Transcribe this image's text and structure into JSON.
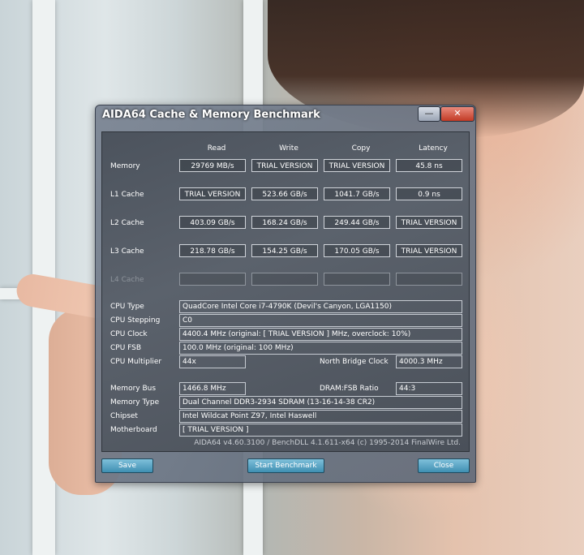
{
  "window": {
    "title": "AIDA64 Cache & Memory Benchmark",
    "min_glyph": "—",
    "close_glyph": "✕"
  },
  "headers": {
    "read": "Read",
    "write": "Write",
    "copy": "Copy",
    "latency": "Latency"
  },
  "rows": [
    {
      "label": "Memory",
      "read": "29769 MB/s",
      "write": "TRIAL VERSION",
      "copy": "TRIAL VERSION",
      "latency": "45.8 ns"
    },
    {
      "label": "L1 Cache",
      "read": "TRIAL VERSION",
      "write": "523.66 GB/s",
      "copy": "1041.7 GB/s",
      "latency": "0.9 ns"
    },
    {
      "label": "L2 Cache",
      "read": "403.09 GB/s",
      "write": "168.24 GB/s",
      "copy": "249.44 GB/s",
      "latency": "TRIAL VERSION"
    },
    {
      "label": "L3 Cache",
      "read": "218.78 GB/s",
      "write": "154.25 GB/s",
      "copy": "170.05 GB/s",
      "latency": "TRIAL VERSION"
    },
    {
      "label": "L4 Cache",
      "read": "",
      "write": "",
      "copy": "",
      "latency": ""
    }
  ],
  "cpu": {
    "type_label": "CPU Type",
    "type": "QuadCore Intel Core i7-4790K  (Devil's Canyon, LGA1150)",
    "stepping_label": "CPU Stepping",
    "stepping": "C0",
    "clock_label": "CPU Clock",
    "clock": "4400.4 MHz  (original: [ TRIAL VERSION ] MHz, overclock: 10%)",
    "fsb_label": "CPU FSB",
    "fsb": "100.0 MHz  (original: 100 MHz)",
    "multiplier_label": "CPU Multiplier",
    "multiplier": "44x",
    "nb_clock_label": "North Bridge Clock",
    "nb_clock": "4000.3 MHz"
  },
  "memory": {
    "bus_label": "Memory Bus",
    "bus": "1466.8 MHz",
    "ratio_label": "DRAM:FSB Ratio",
    "ratio": "44:3",
    "type_label": "Memory Type",
    "type": "Dual Channel DDR3-2934 SDRAM  (13-16-14-38 CR2)",
    "chipset_label": "Chipset",
    "chipset": "Intel Wildcat Point Z97, Intel Haswell",
    "motherboard_label": "Motherboard",
    "motherboard": "[ TRIAL VERSION ]"
  },
  "footer": "AIDA64 v4.60.3100 / BenchDLL 4.1.611-x64  (c) 1995-2014 FinalWire Ltd.",
  "buttons": {
    "save": "Save",
    "start": "Start Benchmark",
    "close": "Close"
  }
}
